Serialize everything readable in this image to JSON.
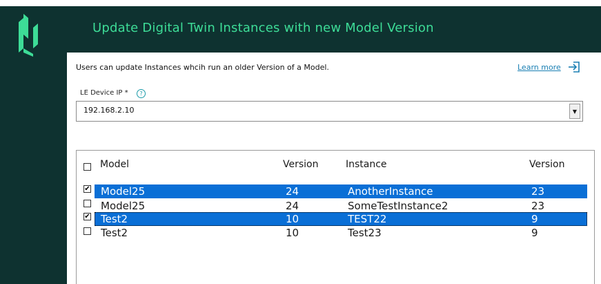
{
  "header": {
    "title": "Update Digital Twin Instances with new Model Version"
  },
  "description": "Users can update Instances whcih run an older Version of a Model.",
  "learn_more": "Learn more",
  "device": {
    "label": "LE Device IP *",
    "help": "?",
    "value": "192.168.2.10",
    "arrow": "▼"
  },
  "table": {
    "headers": [
      "Model",
      "Version",
      "Instance",
      "Version"
    ],
    "rows": [
      {
        "model": "Model25",
        "version": "24",
        "instance": "AnotherInstance",
        "instance_version": "23",
        "checked": true,
        "mark": "✔"
      },
      {
        "model": "Model25",
        "version": "24",
        "instance": "SomeTestInstance2",
        "instance_version": "23",
        "checked": false,
        "mark": ""
      },
      {
        "model": "Test2",
        "version": "10",
        "instance": "TEST22",
        "instance_version": "9",
        "checked": true,
        "mark": "✔"
      },
      {
        "model": "Test2",
        "version": "10",
        "instance": "Test23",
        "instance_version": "9",
        "checked": false,
        "mark": ""
      }
    ]
  },
  "colors": {
    "sidebar": "#0e3230",
    "title": "#3ddc97",
    "link": "#1a7fb3",
    "selection": "#0a6fd6"
  }
}
